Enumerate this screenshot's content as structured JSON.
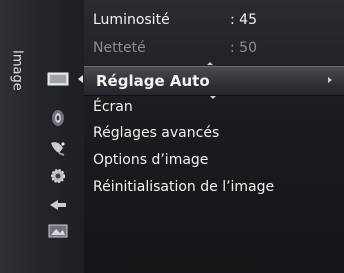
{
  "side_tab": {
    "label": "Image"
  },
  "categories": [
    {
      "name": "picture",
      "icon": "picture-icon",
      "active": true
    },
    {
      "name": "sound",
      "icon": "sound-icon"
    },
    {
      "name": "channel",
      "icon": "channel-icon"
    },
    {
      "name": "setup",
      "icon": "gear-icon"
    },
    {
      "name": "input",
      "icon": "input-icon"
    },
    {
      "name": "application",
      "icon": "application-icon"
    }
  ],
  "menu": {
    "items": [
      {
        "label": "Luminosité",
        "value": ": 45"
      },
      {
        "label": "Netteté",
        "value": ": 50",
        "state": "dim"
      },
      {
        "label": "Réglage Auto",
        "state": "selected"
      },
      {
        "label": "Écran"
      },
      {
        "label": "Réglages avancés"
      },
      {
        "label": "Options d’image"
      },
      {
        "label": "Réinitialisation de l’image"
      }
    ]
  },
  "colors": {
    "selected_bg": "#3a3c41",
    "text": "#f2f2f2",
    "dim_text": "#8a8c92"
  }
}
